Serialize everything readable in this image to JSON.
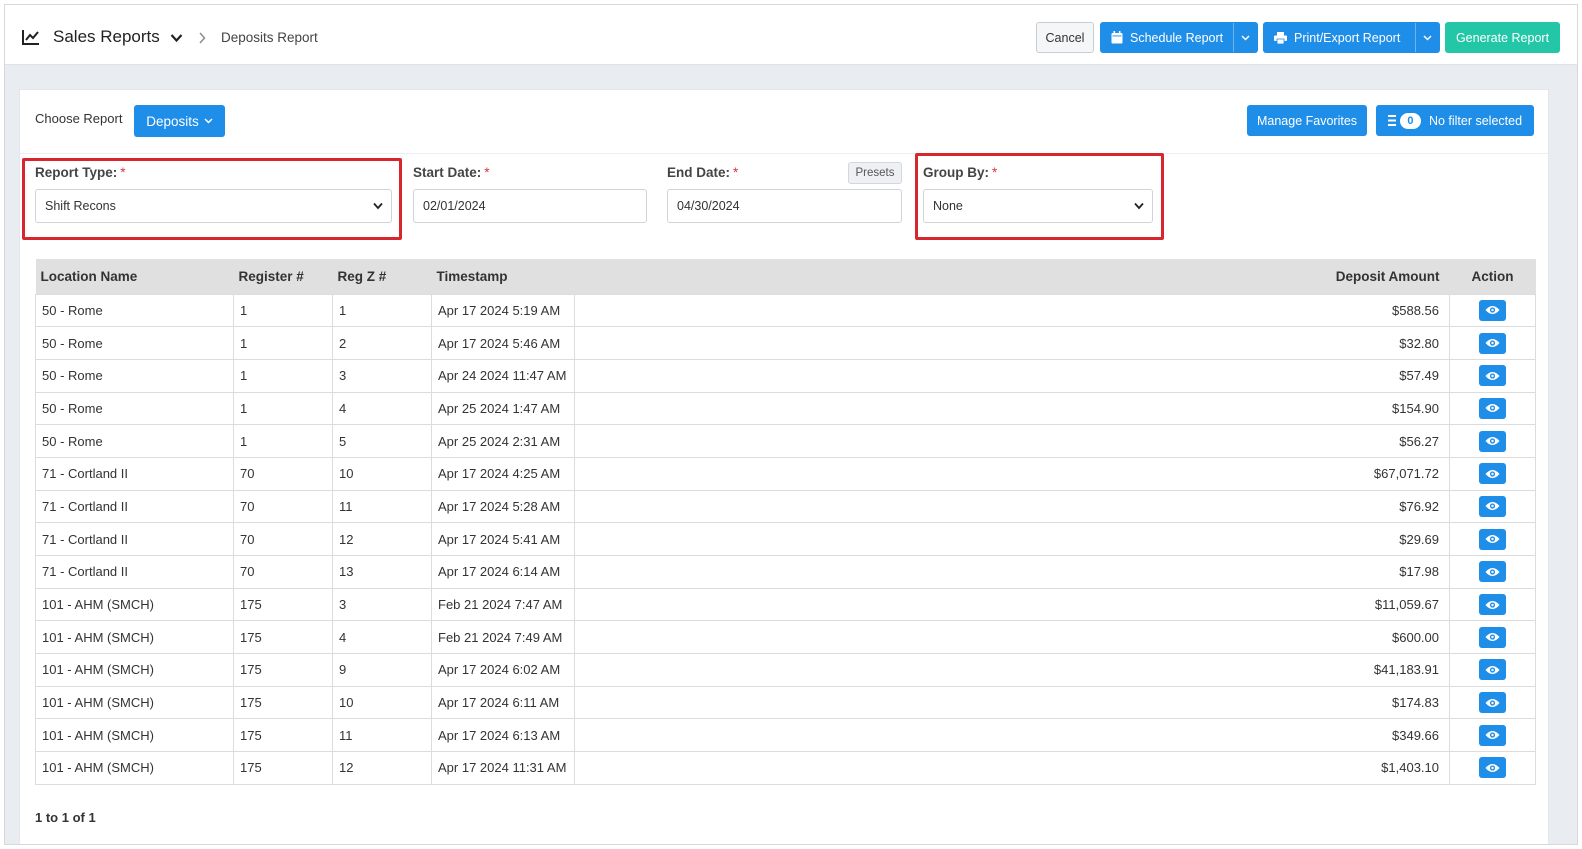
{
  "header": {
    "app_icon": "line-chart-icon",
    "app_title": "Sales Reports",
    "breadcrumb": "Deposits Report",
    "buttons": {
      "cancel": "Cancel",
      "schedule": "Schedule Report",
      "print_export": "Print/Export Report",
      "generate": "Generate Report"
    },
    "colors": {
      "primary": "#1f8ee8",
      "generate": "#24c6a8"
    }
  },
  "toolbar": {
    "choose_label": "Choose Report",
    "report_selected": "Deposits",
    "manage_favorites": "Manage Favorites",
    "filter_count": "0",
    "filter_label": "No filter selected"
  },
  "filters": {
    "report_type": {
      "label": "Report Type:",
      "value": "Shift Recons"
    },
    "start_date": {
      "label": "Start Date:",
      "value": "02/01/2024"
    },
    "end_date": {
      "label": "End Date:",
      "value": "04/30/2024"
    },
    "presets": "Presets",
    "group_by": {
      "label": "Group By:",
      "value": "None"
    },
    "required_mark": "*",
    "highlight_color": "#d7262e"
  },
  "table": {
    "columns": [
      "Location Name",
      "Register #",
      "Reg Z #",
      "Timestamp",
      "Deposit Amount",
      "Action"
    ],
    "action_icon": "eye-icon",
    "rows": [
      [
        "50 - Rome",
        "1",
        "1",
        "Apr 17 2024 5:19 AM",
        "$588.56"
      ],
      [
        "50 - Rome",
        "1",
        "2",
        "Apr 17 2024 5:46 AM",
        "$32.80"
      ],
      [
        "50 - Rome",
        "1",
        "3",
        "Apr 24 2024 11:47 AM",
        "$57.49"
      ],
      [
        "50 - Rome",
        "1",
        "4",
        "Apr 25 2024 1:47 AM",
        "$154.90"
      ],
      [
        "50 - Rome",
        "1",
        "5",
        "Apr 25 2024 2:31 AM",
        "$56.27"
      ],
      [
        "71 - Cortland II",
        "70",
        "10",
        "Apr 17 2024 4:25 AM",
        "$67,071.72"
      ],
      [
        "71 - Cortland II",
        "70",
        "11",
        "Apr 17 2024 5:28 AM",
        "$76.92"
      ],
      [
        "71 - Cortland II",
        "70",
        "12",
        "Apr 17 2024 5:41 AM",
        "$29.69"
      ],
      [
        "71 - Cortland II",
        "70",
        "13",
        "Apr 17 2024 6:14 AM",
        "$17.98"
      ],
      [
        "101 - AHM (SMCH)",
        "175",
        "3",
        "Feb 21 2024 7:47 AM",
        "$11,059.67"
      ],
      [
        "101 - AHM (SMCH)",
        "175",
        "4",
        "Feb 21 2024 7:49 AM",
        "$600.00"
      ],
      [
        "101 - AHM (SMCH)",
        "175",
        "9",
        "Apr 17 2024 6:02 AM",
        "$41,183.91"
      ],
      [
        "101 - AHM (SMCH)",
        "175",
        "10",
        "Apr 17 2024 6:11 AM",
        "$174.83"
      ],
      [
        "101 - AHM (SMCH)",
        "175",
        "11",
        "Apr 17 2024 6:13 AM",
        "$349.66"
      ],
      [
        "101 - AHM (SMCH)",
        "175",
        "12",
        "Apr 17 2024 11:31 AM",
        "$1,403.10"
      ]
    ]
  },
  "pagination": "1 to 1 of 1"
}
